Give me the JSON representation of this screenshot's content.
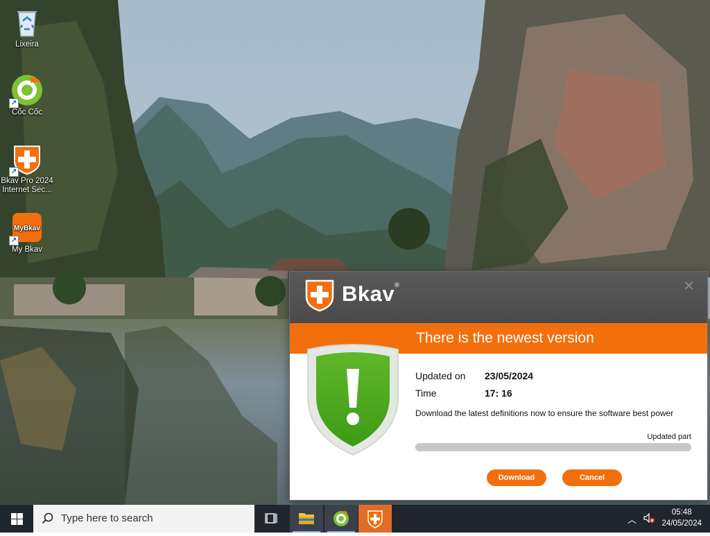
{
  "desktop": {
    "icons": [
      {
        "label": "Lixeira",
        "icon": "recycle-bin-icon"
      },
      {
        "label": "Cốc Cốc",
        "icon": "coccoc-browser-icon"
      },
      {
        "label": "Bkav Pro 2024 Internet Sec...",
        "icon": "bkav-shield-icon"
      },
      {
        "label": "My Bkav",
        "icon": "mybkav-icon"
      }
    ]
  },
  "dialog": {
    "brand": "Bkav",
    "title": "There is the newest version",
    "updated_on_label": "Updated on",
    "updated_on_value": "23/05/2024",
    "time_label": "Time",
    "time_value": "17: 16",
    "description": "Download the latest definitions now to ensure the software best power",
    "updated_part_label": "Updated part",
    "progress_fraction": 0,
    "download_label": "Download",
    "cancel_label": "Cancel",
    "colors": {
      "accent": "#f36f0d",
      "header": "#4f4f4f",
      "shield_green": "#4aa51b"
    }
  },
  "taskbar": {
    "search_placeholder": "Type here to search",
    "apps": [
      "task-view-icon",
      "file-explorer-icon",
      "coccoc-browser-icon",
      "bkav-shield-icon"
    ],
    "clock_time": "05:48",
    "clock_date": "24/05/2024"
  }
}
